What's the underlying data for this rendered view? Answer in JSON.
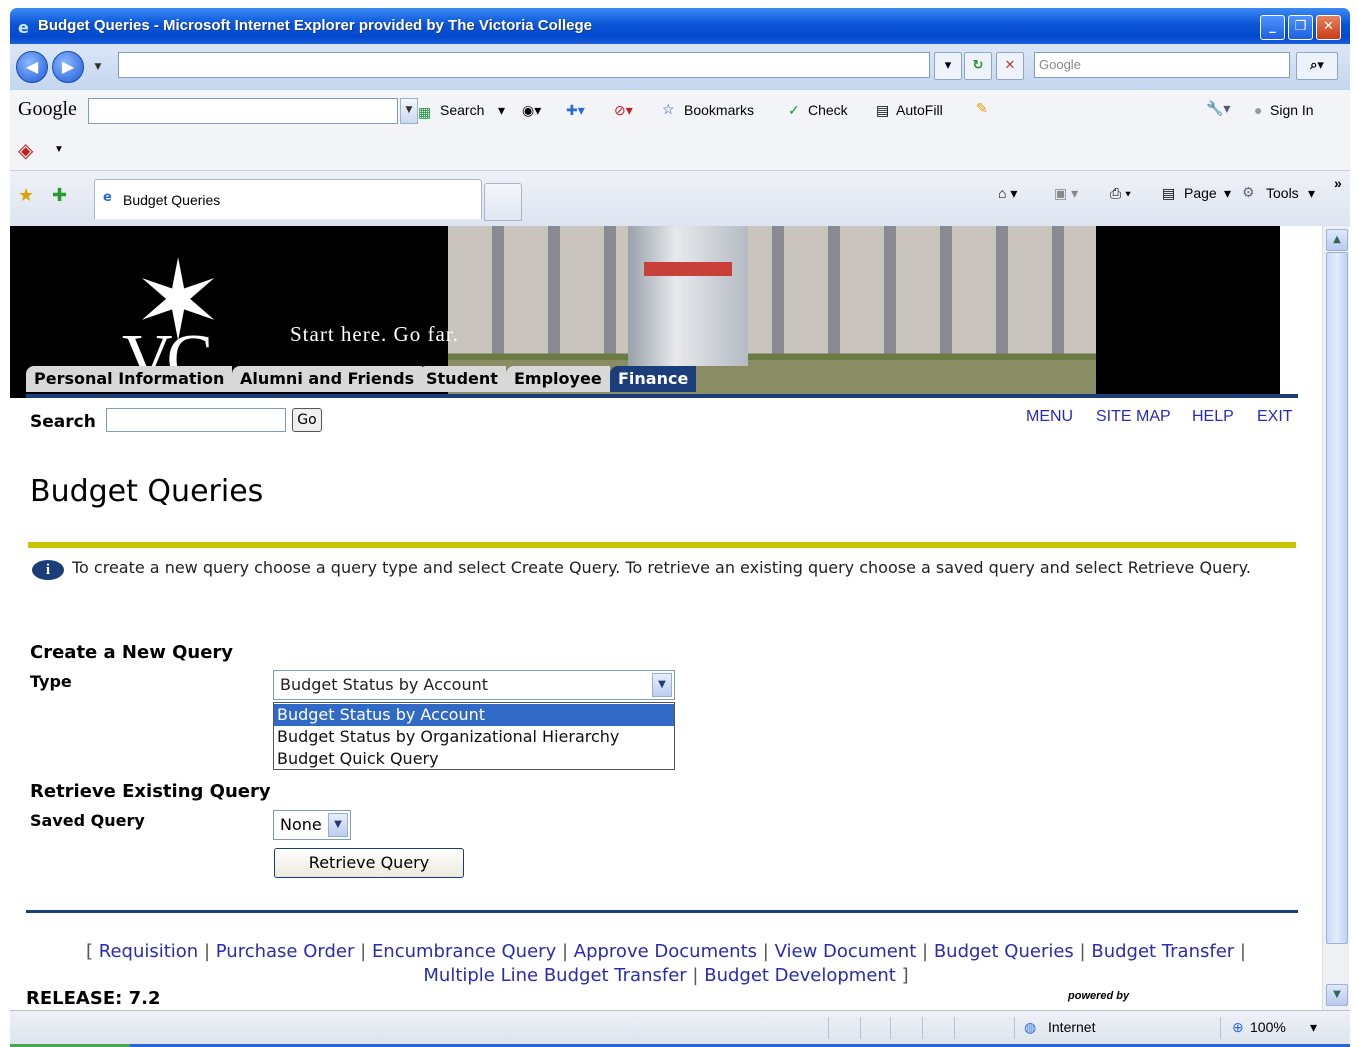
{
  "window": {
    "title": "Budget Queries - Microsoft Internet Explorer provided by The Victoria College",
    "min": "_",
    "max": "❐",
    "close": "✕"
  },
  "addressbar": {
    "url": "",
    "search_placeholder": "Google"
  },
  "google_toolbar": {
    "logo": "Google",
    "search": "Search",
    "bookmarks": "Bookmarks",
    "check": "Check",
    "autofill": "AutoFill",
    "signin": "Sign In"
  },
  "tabbar": {
    "tab_label": "Budget Queries",
    "page": "Page",
    "tools": "Tools"
  },
  "banner": {
    "tagline": "Start here.  Go far.",
    "logo_text": "VC"
  },
  "nav_tabs": [
    {
      "label": "Personal Information"
    },
    {
      "label": "Alumni and Friends"
    },
    {
      "label": "Student"
    },
    {
      "label": "Employee"
    },
    {
      "label": "Finance"
    }
  ],
  "search": {
    "label": "Search",
    "go": "Go"
  },
  "top_links": {
    "menu": "MENU",
    "sitemap": "SITE MAP",
    "help": "HELP",
    "exit": "EXIT"
  },
  "page": {
    "title": "Budget Queries",
    "info": "To create a new query choose a query type and select Create Query. To retrieve an existing query choose a saved query and select Retrieve Query.",
    "create_heading": "Create a New Query",
    "type_label": "Type",
    "type_selected": "Budget Status by Account",
    "type_options": [
      "Budget Status by Account",
      "Budget Status by Organizational Hierarchy",
      "Budget Quick Query"
    ],
    "retrieve_heading": "Retrieve Existing Query",
    "saved_label": "Saved Query",
    "saved_selected": "None",
    "retrieve_button": "Retrieve Query"
  },
  "footer": {
    "open": "[",
    "close": "]",
    "sep": "|",
    "links": [
      "Requisition",
      "Purchase Order",
      "Encumbrance Query",
      "Approve Documents",
      "View Document",
      "Budget Queries",
      "Budget Transfer",
      "Multiple Line Budget Transfer",
      "Budget Development"
    ],
    "release": "RELEASE: 7.2",
    "powered_by": "powered by"
  },
  "statusbar": {
    "zone": "Internet",
    "zoom": "100%"
  },
  "colors": {
    "nav_blue": "#1b3d7a",
    "olive_rule": "#c9c400",
    "link": "#2a2ab8",
    "select_highlight": "#3169c6"
  }
}
